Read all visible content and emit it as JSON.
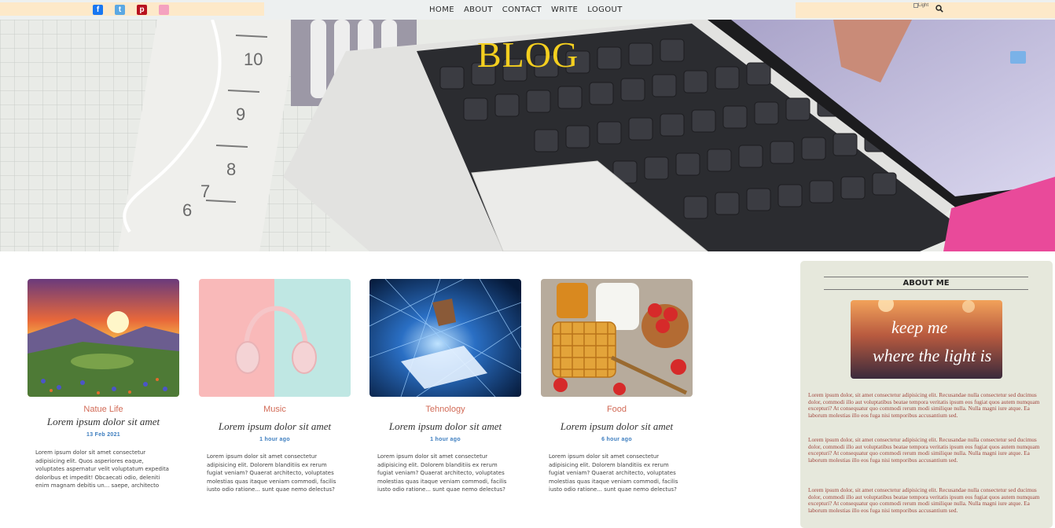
{
  "social": {
    "facebook": "f",
    "twitter": "t",
    "pinterest": "p",
    "instagram": ""
  },
  "nav": [
    "HOME",
    "ABOUT",
    "CONTACT",
    "WRITE",
    "LOGOUT"
  ],
  "tools": {
    "light_toggle": "Light",
    "search_icon": "search-icon"
  },
  "hero": {
    "title": "BLOG"
  },
  "posts": [
    {
      "category": "Natue  Life",
      "title": "Lorem ipsum dolor sit amet",
      "date": "13 Feb 2021",
      "desc": "Lorem ipsum dolor sit amet consectetur adipisicing elit. Quos asperiores eaque, voluptates aspernatur velit voluptatum expedita doloribus et impedit! Obcaecati odio, deleniti enim magnam debitis un... saepe, architecto doloremque voluptatem natus"
    },
    {
      "category": "Music",
      "title": "Lorem ipsum dolor sit amet",
      "date": "1 hour ago",
      "desc": "Lorem ipsum dolor sit amet consectetur adipisicing elit. Dolorem blanditiis ex rerum fugiat veniam? Quaerat architecto, voluptates molestias quas itaque veniam commodi, facilis iusto odio ratione... sunt quae nemo delectus?Lorem ipsum dolor sit"
    },
    {
      "category": "Tehnology",
      "title": "Lorem ipsum dolor sit amet",
      "date": "1 hour ago",
      "desc": "Lorem ipsum dolor sit amet consectetur adipisicing elit. Dolorem blanditiis ex rerum fugiat veniam? Quaerat architecto, voluptates molestias quas itaque veniam commodi, facilis iusto odio ratione... sunt quae nemo delectus?Lorem ipsum dolor sit"
    },
    {
      "category": "Food",
      "title": "Lorem ipsum dolor sit amet",
      "date": "6 hour ago",
      "desc": "Lorem ipsum dolor sit amet consectetur adipisicing elit. Dolorem blanditiis ex rerum fugiat veniam? Quaerat architecto, voluptates molestias quas itaque veniam commodi, facilis iusto odio ratione... sunt quae nemo delectus?Lorem ipsum dolor sit"
    }
  ],
  "sidebar": {
    "about_title": "ABOUT ME",
    "image_quote_1": "keep me",
    "image_quote_2": "where the light is",
    "paragraphs": [
      "Lorem ipsum dolor, sit amet consectetur adipisicing elit. Recusandae nulla consectetur sed ducimus dolor, commodi illo aut voluptatibus beatae tempora veritatis ipsum eos fugiat quos autem numquam excepturi? At consequatur quo commodi rerum modi similique nulla. Nulla magni iure atque. Ea laborum molestias illo eos fuga nisi temporibus accusantium sed.",
      "Lorem ipsum dolor, sit amet consectetur adipisicing elit. Recusandae nulla consectetur sed ducimus dolor, commodi illo aut voluptatibus beatae tempora veritatis ipsum eos fugiat quos autem numquam excepturi? At consequatur quo commodi rerum modi similique nulla. Nulla magni iure atque. Ea laborum molestias illo eos fuga nisi temporibus accusantium sed.",
      "Lorem ipsum dolor, sit amet consectetur adipisicing elit. Recusandae nulla consectetur sed ducimus dolor, commodi illo aut voluptatibus beatae tempora veritatis ipsum eos fugiat quos autem numquam excepturi? At consequatur quo commodi rerum modi similique nulla. Nulla magni iure atque. Ea laborum molestias illo eos fuga nisi temporibus accusantium sed."
    ]
  },
  "colors": {
    "hero_title": "#f4cf1f",
    "category": "#d26b57",
    "date": "#3c7dbf",
    "sidebar_bg": "#e6e8dc",
    "sidebar_text": "#a0453d",
    "topbar_accent": "#fde9c9"
  }
}
